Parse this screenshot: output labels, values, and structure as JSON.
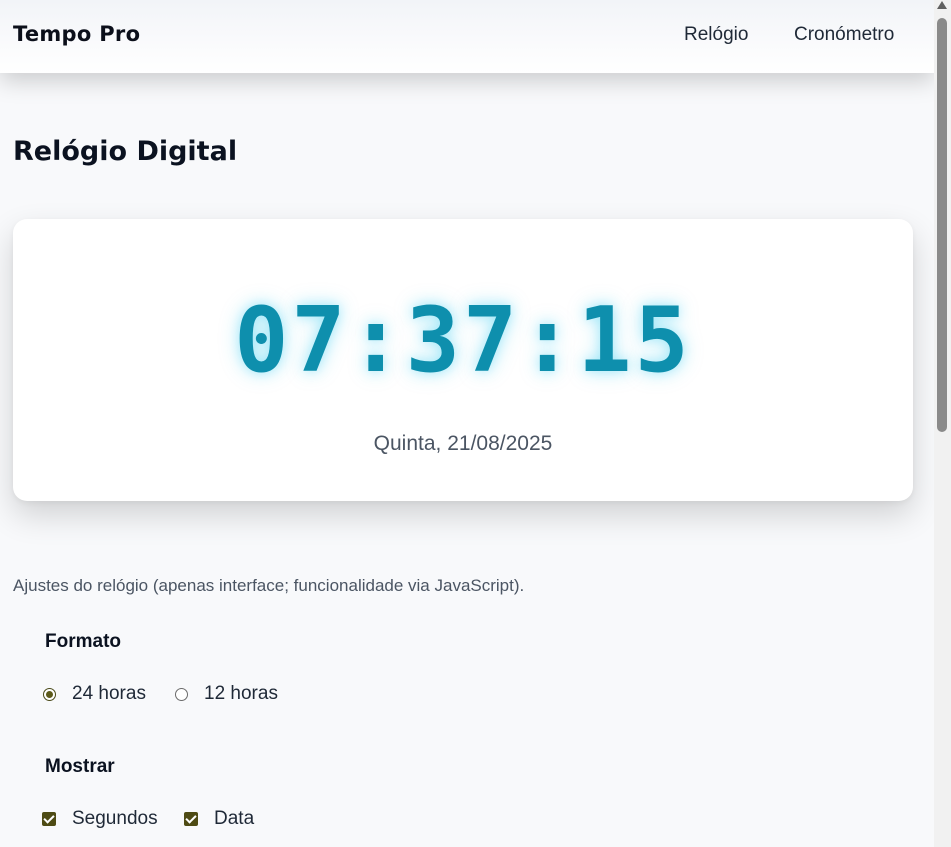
{
  "nav": {
    "brand": "Tempo Pro",
    "links": [
      {
        "label": "Relógio"
      },
      {
        "label": "Cronómetro"
      }
    ]
  },
  "page": {
    "title": "Relógio Digital"
  },
  "clock": {
    "time": "07:37:15",
    "date": "Quinta, 21/08/2025",
    "color": "#0e8fad"
  },
  "settings": {
    "description": "Ajustes do relógio (apenas interface; funcionalidade via JavaScript).",
    "format": {
      "label": "Formato",
      "options": [
        {
          "label": "24 horas",
          "checked": true
        },
        {
          "label": "12 horas",
          "checked": false
        }
      ]
    },
    "show": {
      "label": "Mostrar",
      "options": [
        {
          "label": "Segundos",
          "checked": true
        },
        {
          "label": "Data",
          "checked": true
        }
      ]
    }
  }
}
